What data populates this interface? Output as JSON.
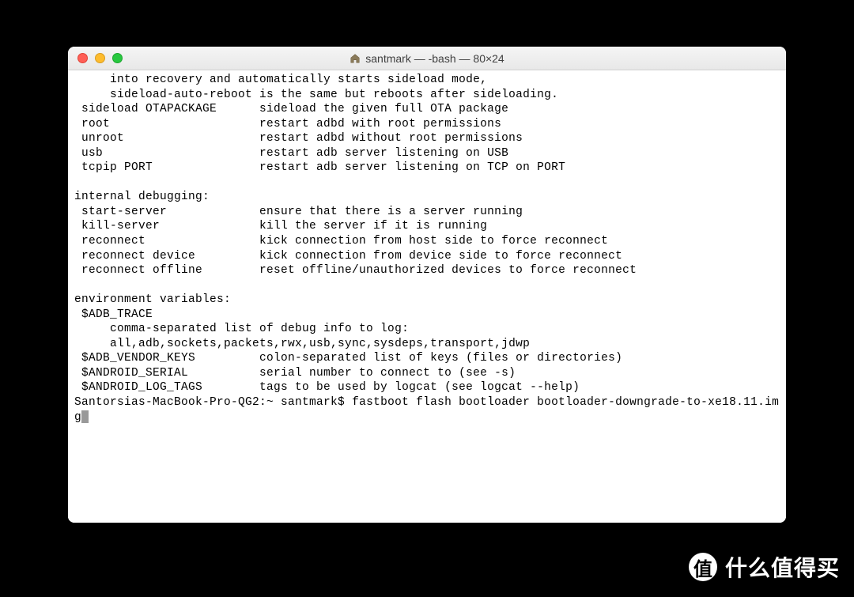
{
  "window": {
    "title": "santmark — -bash — 80×24"
  },
  "terminal": {
    "lines": [
      "     into recovery and automatically starts sideload mode,",
      "     sideload-auto-reboot is the same but reboots after sideloading.",
      " sideload OTAPACKAGE      sideload the given full OTA package",
      " root                     restart adbd with root permissions",
      " unroot                   restart adbd without root permissions",
      " usb                      restart adb server listening on USB",
      " tcpip PORT               restart adb server listening on TCP on PORT",
      "",
      "internal debugging:",
      " start-server             ensure that there is a server running",
      " kill-server              kill the server if it is running",
      " reconnect                kick connection from host side to force reconnect",
      " reconnect device         kick connection from device side to force reconnect",
      " reconnect offline        reset offline/unauthorized devices to force reconnect",
      "",
      "environment variables:",
      " $ADB_TRACE",
      "     comma-separated list of debug info to log:",
      "     all,adb,sockets,packets,rwx,usb,sync,sysdeps,transport,jdwp",
      " $ADB_VENDOR_KEYS         colon-separated list of keys (files or directories)",
      " $ANDROID_SERIAL          serial number to connect to (see -s)",
      " $ANDROID_LOG_TAGS        tags to be used by logcat (see logcat --help)"
    ],
    "prompt": "Santorsias-MacBook-Pro-QG2:~ santmark$ ",
    "command": "fastboot flash bootloader bootloader-downgrade-to-xe18.11.img"
  },
  "watermark": {
    "badge": "值",
    "text": "什么值得买"
  }
}
